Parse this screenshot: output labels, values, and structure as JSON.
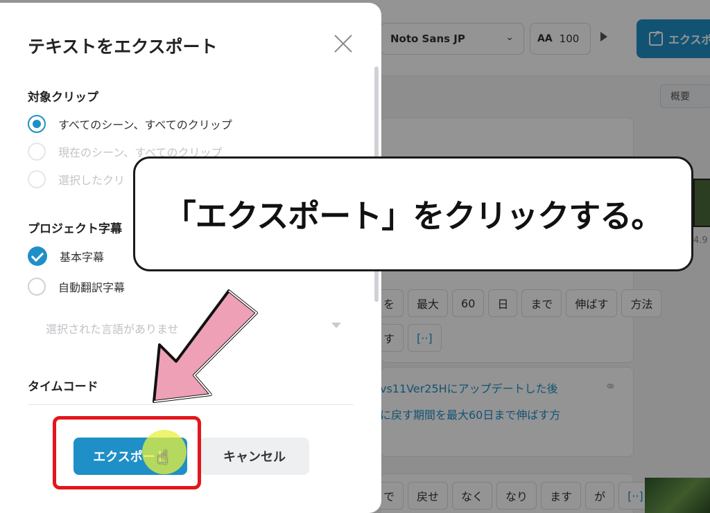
{
  "background": {
    "font_select": "Noto Sans JP",
    "font_size_icon": "AA",
    "font_size_value": "100",
    "export_button": "エクスポ",
    "summary_tab": "概要",
    "chips_row1": [
      "を",
      "最大",
      "60",
      "日",
      "まで",
      "伸ばす",
      "方法"
    ],
    "chips_row2": [
      "す",
      "[··]"
    ],
    "chips_row3": [
      "で",
      "戻せ",
      "なく",
      "なり",
      "ます",
      "が",
      "[··]"
    ],
    "line1": "vs11Ver25Hにアップデートした後",
    "line2": "に戻す期間を最大60日まで伸ばす方",
    "thumb_label": "4.9"
  },
  "dialog": {
    "title": "テキストをエクスポート",
    "section_clip": "対象クリップ",
    "clip_options": [
      "すべてのシーン、すべてのクリップ",
      "現在のシーン、すべてのクリップ",
      "選択したクリ"
    ],
    "section_subtitle": "プロジェクト字幕",
    "subtitle_options": [
      "基本字幕",
      "自動翻訳字幕"
    ],
    "language_placeholder": "選択された言語がありませ",
    "section_timecode": "タイムコード",
    "export_button": "エクスポート",
    "cancel_button": "キャンセル"
  },
  "annotation": {
    "callout": "「エクスポート」をクリックする。"
  },
  "colors": {
    "accent": "#1f8fc7",
    "highlight_red": "#e3161b",
    "arrow_pink": "#eea0b6",
    "cursor_glow": "#e8f03c"
  }
}
